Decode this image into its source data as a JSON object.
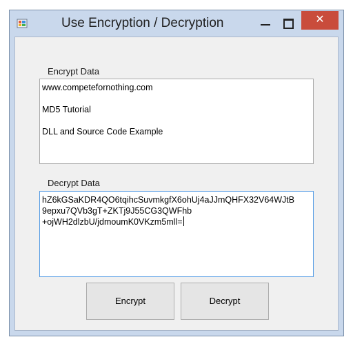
{
  "window": {
    "title": "Use Encryption / Decryption",
    "close_glyph": "✕"
  },
  "encrypt": {
    "label": "Encrypt Data",
    "lines": [
      "www.competefornothing.com",
      "",
      "MD5 Tutorial",
      "",
      "DLL and Source Code Example"
    ]
  },
  "decrypt": {
    "label": "Decrypt Data",
    "lines": [
      "hZ6kGSaKDR4QO6tqihcSuvmkgfX6ohUj4aJJmQHFX32V64WJtB",
      "9epxu7QVb3gT+ZKTj9J55CG3QWFhb",
      "+ojWH2dlzbU/jdmoumK0VKzm5mll="
    ]
  },
  "buttons": {
    "encrypt_label": "Encrypt",
    "decrypt_label": "Decrypt"
  },
  "colors": {
    "close_button": "#c94c3c",
    "focus_border": "#569de5",
    "window_frame": "#c9d8ec"
  }
}
